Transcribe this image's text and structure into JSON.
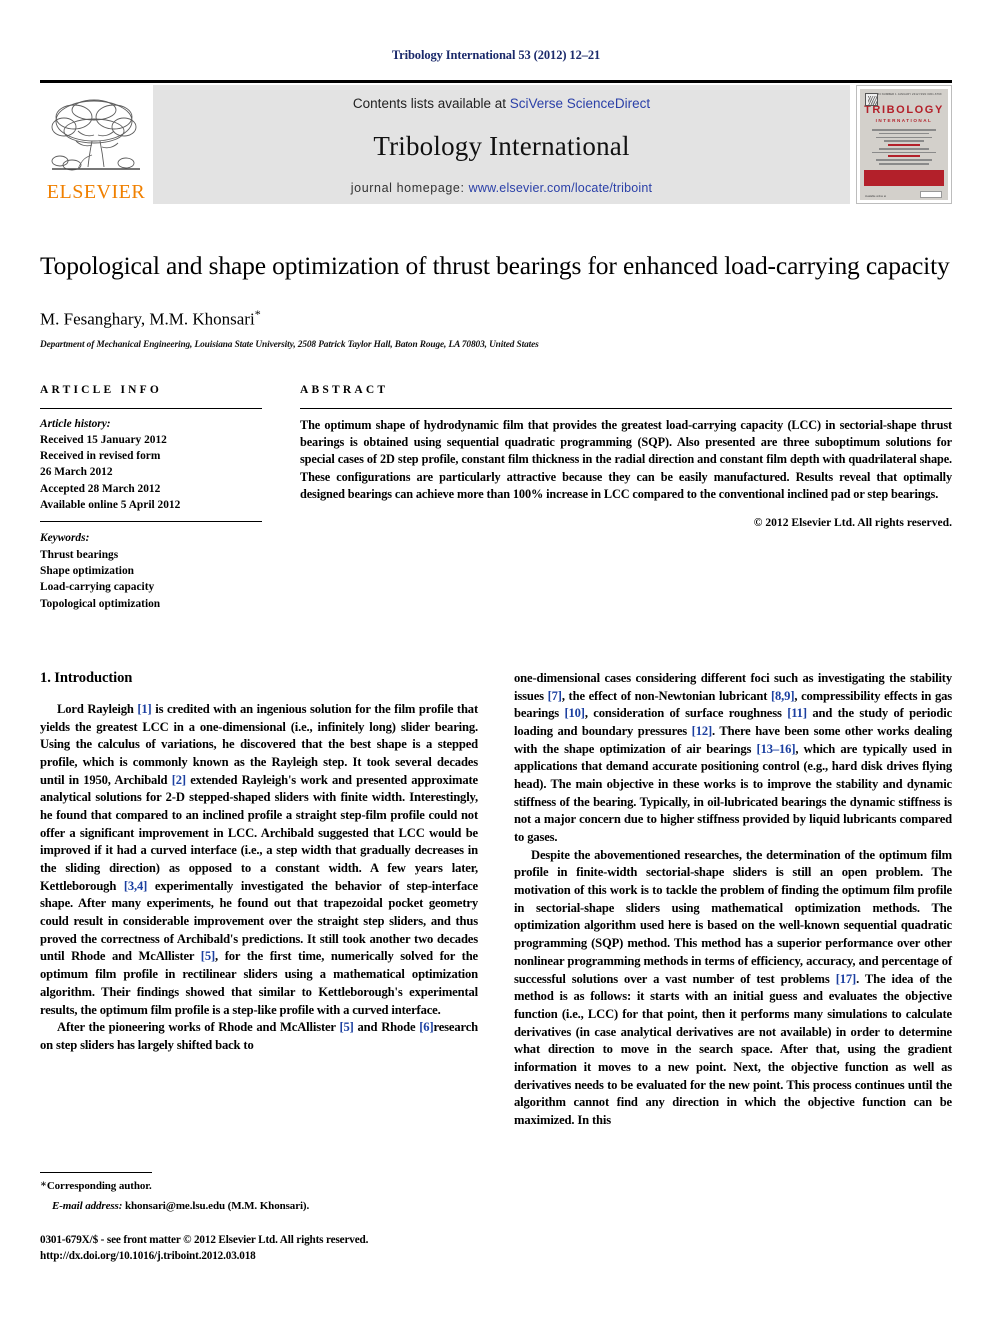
{
  "running_head": "Tribology International 53 (2012) 12–21",
  "masthead": {
    "publisher_name": "ELSEVIER",
    "contents_prefix": "Contents lists available at ",
    "contents_link": "SciVerse ScienceDirect",
    "journal_title": "Tribology International",
    "homepage_prefix": "journal homepage: ",
    "homepage_url": "www.elsevier.com/locate/triboint",
    "cover": {
      "top_caption": "VOL. 53 NUMBER 1 JANUARY 2012 ISSN 0301-679X",
      "title": "TRIBOLOGY",
      "subtitle": "INTERNATIONAL",
      "footer_caption": "Available online at",
      "accent_color": "#b3202a",
      "background_color": "#d3d0cb"
    },
    "band_color": "#e3e3e3",
    "link_color": "#2b40a8",
    "logo_color": "#f08000"
  },
  "article": {
    "title": "Topological and shape optimization of thrust bearings for enhanced load-carrying capacity",
    "authors": "M. Fesanghary, M.M. Khonsari",
    "corresponding_marker": "*",
    "affiliation": "Department of Mechanical Engineering, Louisiana State University, 2508 Patrick Taylor Hall, Baton Rouge, LA 70803, United States"
  },
  "article_info": {
    "heading": "ARTICLE INFO",
    "history_label": "Article history:",
    "history": [
      "Received 15 January 2012",
      "Received in revised form",
      "26 March 2012",
      "Accepted 28 March 2012",
      "Available online 5 April 2012"
    ],
    "keywords_label": "Keywords:",
    "keywords": [
      "Thrust bearings",
      "Shape optimization",
      "Load-carrying capacity",
      "Topological optimization"
    ]
  },
  "abstract": {
    "heading": "ABSTRACT",
    "text": "The optimum shape of hydrodynamic film that provides the greatest load-carrying capacity (LCC) in sectorial-shape thrust bearings is obtained using sequential quadratic programming (SQP). Also presented are three suboptimum solutions for special cases of 2D step profile, constant film thickness in the radial direction and constant film depth with quadrilateral shape. These configurations are particularly attractive because they can be easily manufactured. Results reveal that optimally designed bearings can achieve more than 100% increase in LCC compared to the conventional inclined pad or step bearings.",
    "copyright": "© 2012 Elsevier Ltd. All rights reserved."
  },
  "body": {
    "section_number_title": "1.  Introduction",
    "left_paragraphs": [
      "Lord Rayleigh [1] is credited with an ingenious solution for the film profile that yields the greatest LCC in a one-dimensional (i.e., infinitely long) slider bearing. Using the calculus of variations, he discovered that the best shape is a stepped profile, which is commonly known as the Rayleigh step. It took several decades until in 1950, Archibald [2] extended Rayleigh's work and presented approximate analytical solutions for 2-D stepped-shaped sliders with finite width. Interestingly, he found that compared to an inclined profile a straight step-film profile could not offer a significant improvement in LCC. Archibald suggested that LCC would be improved if it had a curved interface (i.e., a step width that gradually decreases in the sliding direction) as opposed to a constant width. A few years later, Kettleborough [3,4] experimentally investigated the behavior of step-interface shape. After many experiments, he found out that trapezoidal pocket geometry could result in considerable improvement over the straight step sliders, and thus proved the correctness of Archibald's predictions. It still took another two decades until Rhode and McAllister [5], for the first time, numerically solved for the optimum film profile in rectilinear sliders using a mathematical optimization algorithm. Their findings showed that similar to Kettleborough's experimental results, the optimum film profile is a step-like profile with a curved interface.",
      "After the pioneering works of Rhode and McAllister [5] and Rhode [6]research on step sliders has largely shifted back to"
    ],
    "right_paragraphs": [
      "one-dimensional cases considering different foci such as investigating the stability issues [7], the effect of non-Newtonian lubricant [8,9], compressibility effects in gas bearings [10], consideration of surface roughness [11] and the study of periodic loading and boundary pressures [12]. There have been some other works dealing with the shape optimization of air bearings [13–16], which are typically used in applications that demand accurate positioning control (e.g., hard disk drives flying head). The main objective in these works is to improve the stability and dynamic stiffness of the bearing. Typically, in oil-lubricated bearings the dynamic stiffness is not a major concern due to higher stiffness provided by liquid lubricants compared to gases.",
      "Despite the abovementioned researches, the determination of the optimum film profile in finite-width sectorial-shape sliders is still an open problem. The motivation of this work is to tackle the problem of finding the optimum film profile in sectorial-shape sliders using mathematical optimization methods. The optimization algorithm used here is based on the well-known sequential quadratic programming (SQP) method. This method has a superior performance over other nonlinear programming methods in terms of efficiency, accuracy, and percentage of successful solutions over a vast number of test problems [17]. The idea of the method is as follows: it starts with an initial guess and evaluates the objective function (i.e., LCC) for that point, then it performs many simulations to calculate derivatives (in case analytical derivatives are not available) in order to determine what direction to move in the search space. After that, using the gradient information it moves to a new point. Next, the objective function as well as derivatives needs to be evaluated for the new point. This process continues until the algorithm cannot find any direction in which the objective function can be maximized. In this"
    ],
    "reference_color": "#1b3fa0"
  },
  "footnote": {
    "corresponding": "Corresponding author.",
    "email_label": "E-mail address:",
    "email": "khonsari@me.lsu.edu (M.M. Khonsari).",
    "issn_line": "0301-679X/$ - see front matter © 2012 Elsevier Ltd. All rights reserved.",
    "doi_line": "http://dx.doi.org/10.1016/j.triboint.2012.03.018"
  }
}
